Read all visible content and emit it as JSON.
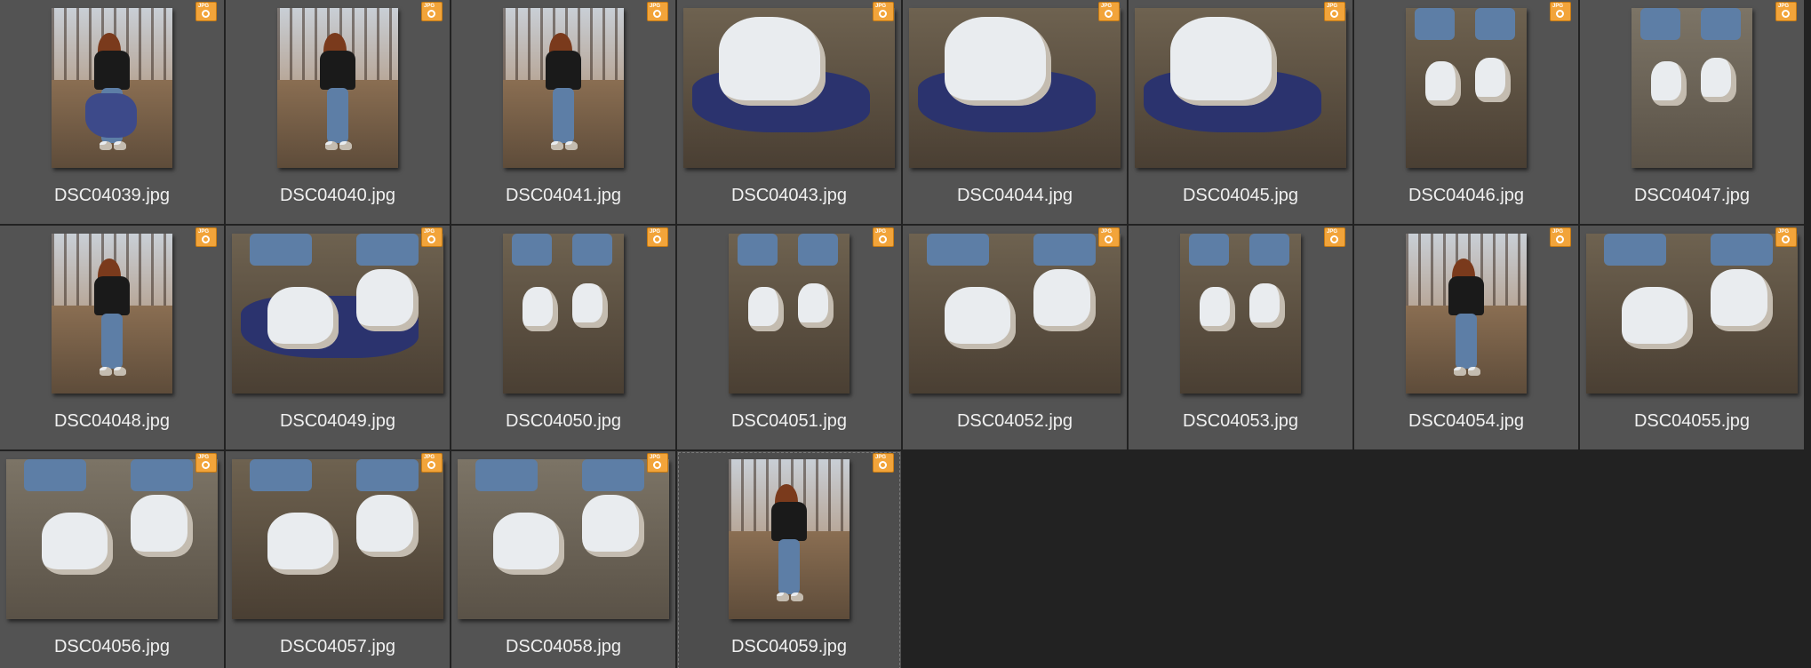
{
  "badge_text": "JPG",
  "thumbnails": [
    {
      "filename": "DSC04039.jpg",
      "orientation": "portrait",
      "scene": "person-tshirt"
    },
    {
      "filename": "DSC04040.jpg",
      "orientation": "portrait",
      "scene": "person-standing"
    },
    {
      "filename": "DSC04041.jpg",
      "orientation": "portrait",
      "scene": "person-bending"
    },
    {
      "filename": "DSC04043.jpg",
      "orientation": "landscape",
      "scene": "shoe-closeup"
    },
    {
      "filename": "DSC04044.jpg",
      "orientation": "landscape",
      "scene": "shoe-closeup"
    },
    {
      "filename": "DSC04045.jpg",
      "orientation": "landscape",
      "scene": "shoe-closeup"
    },
    {
      "filename": "DSC04046.jpg",
      "orientation": "portrait",
      "scene": "feet"
    },
    {
      "filename": "DSC04047.jpg",
      "orientation": "portrait",
      "scene": "feet-puddle"
    },
    {
      "filename": "DSC04048.jpg",
      "orientation": "portrait",
      "scene": "person-kick"
    },
    {
      "filename": "DSC04049.jpg",
      "orientation": "landscape",
      "scene": "shoes-cloth"
    },
    {
      "filename": "DSC04050.jpg",
      "orientation": "portrait",
      "scene": "feet"
    },
    {
      "filename": "DSC04051.jpg",
      "orientation": "portrait",
      "scene": "feet"
    },
    {
      "filename": "DSC04052.jpg",
      "orientation": "landscape",
      "scene": "shoes-mud"
    },
    {
      "filename": "DSC04053.jpg",
      "orientation": "portrait",
      "scene": "feet"
    },
    {
      "filename": "DSC04054.jpg",
      "orientation": "portrait",
      "scene": "person-standing"
    },
    {
      "filename": "DSC04055.jpg",
      "orientation": "landscape",
      "scene": "shoes-mud"
    },
    {
      "filename": "DSC04056.jpg",
      "orientation": "landscape",
      "scene": "shoes-water"
    },
    {
      "filename": "DSC04057.jpg",
      "orientation": "landscape",
      "scene": "shoes-mud"
    },
    {
      "filename": "DSC04058.jpg",
      "orientation": "landscape",
      "scene": "shoes-water"
    },
    {
      "filename": "DSC04059.jpg",
      "orientation": "portrait",
      "scene": "person-bending",
      "selected": true
    }
  ],
  "colors": {
    "background": "#222222",
    "cell": "#535353",
    "label": "#f0f0f0",
    "badge": "#f2a43a"
  }
}
